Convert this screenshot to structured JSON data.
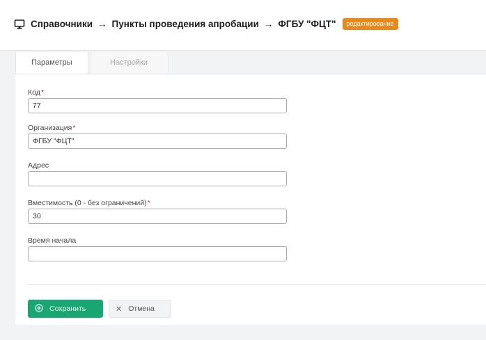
{
  "breadcrumb": {
    "items": [
      "Справочники",
      "Пункты проведения апробации",
      "ФГБУ \"ФЦТ\""
    ],
    "separator": "→",
    "badge": "редактирование",
    "icon": "monitor-icon"
  },
  "tabs": [
    {
      "label": "Параметры",
      "active": true
    },
    {
      "label": "Настройки",
      "active": false
    }
  ],
  "form": {
    "code": {
      "label": "Код",
      "required": "*",
      "value": "77"
    },
    "organization": {
      "label": "Организация",
      "required": "*",
      "value": "ФГБУ \"ФЦТ\""
    },
    "address": {
      "label": "Адрес",
      "value": ""
    },
    "capacity": {
      "label": "Вместимость (0 - без ограничений)",
      "required": "*",
      "value": "30"
    },
    "start_time": {
      "label": "Время начала",
      "value": ""
    }
  },
  "actions": {
    "save_label": "Сохранить",
    "cancel_label": "Отмена",
    "save_icon": "plus-circle-icon",
    "cancel_icon": "close-icon"
  },
  "colors": {
    "badge": "#e8891d",
    "save_button": "#1aa673",
    "required_mark": "#c0392b"
  }
}
